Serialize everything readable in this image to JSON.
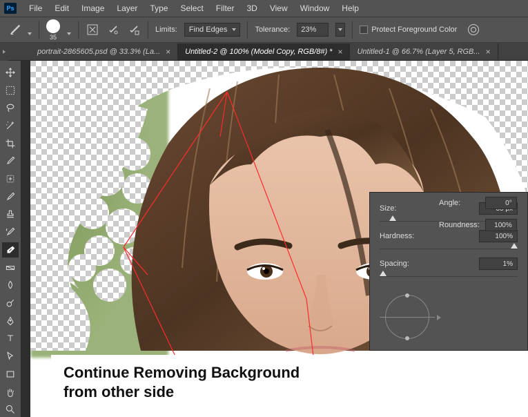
{
  "menu": [
    "File",
    "Edit",
    "Image",
    "Layer",
    "Type",
    "Select",
    "Filter",
    "3D",
    "View",
    "Window",
    "Help"
  ],
  "options": {
    "brush_size": "35",
    "limits_label": "Limits:",
    "limits_value": "Find Edges",
    "tolerance_label": "Tolerance:",
    "tolerance_value": "23%",
    "protect_label": "Protect Foreground Color"
  },
  "tabs": [
    {
      "label": "portrait-2865605.psd @ 33.3% (La...",
      "active": false
    },
    {
      "label": "Untitled-2 @ 100% (Model Copy, RGB/8#) *",
      "active": true
    },
    {
      "label": "Untitled-1 @ 66.7% (Layer 5, RGB...",
      "active": false
    }
  ],
  "panel": {
    "size_label": "Size:",
    "size_value": "35 px",
    "hardness_label": "Hardness:",
    "hardness_value": "100%",
    "spacing_label": "Spacing:",
    "spacing_value": "1%",
    "angle_label": "Angle:",
    "angle_value": "0°",
    "roundness_label": "Roundness:",
    "roundness_value": "100%"
  },
  "annotation": {
    "line1": "Continue Removing Background",
    "line2": "from other side"
  }
}
